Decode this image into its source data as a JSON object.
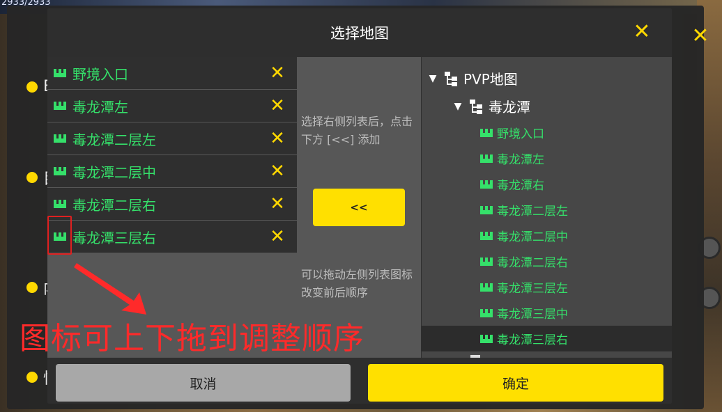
{
  "background": {
    "hp_text": "2933/2933",
    "side_rows": [
      {
        "label": "B"
      },
      {
        "label": "目"
      },
      {
        "label": "内"
      },
      {
        "label": "快"
      }
    ]
  },
  "dialog": {
    "title": "选择地图",
    "close_icon": "close-icon",
    "selected_maps": [
      {
        "name": "野境入口"
      },
      {
        "name": "毒龙潭左"
      },
      {
        "name": "毒龙潭二层左"
      },
      {
        "name": "毒龙潭二层中"
      },
      {
        "name": "毒龙潭二层右"
      },
      {
        "name": "毒龙潭三层右"
      }
    ],
    "hint_top": "选择右侧列表后，点击下方 [<<] 添加",
    "add_button": "<<",
    "hint_bottom": "可以拖动左侧列表图标改变前后顺序",
    "tree": {
      "root": "PVP地图",
      "group": "毒龙潭",
      "leaves": [
        {
          "name": "野境入口",
          "selected": false
        },
        {
          "name": "毒龙潭左",
          "selected": false
        },
        {
          "name": "毒龙潭右",
          "selected": false
        },
        {
          "name": "毒龙潭二层左",
          "selected": false
        },
        {
          "name": "毒龙潭二层中",
          "selected": false
        },
        {
          "name": "毒龙潭二层右",
          "selected": false
        },
        {
          "name": "毒龙潭三层左",
          "selected": false
        },
        {
          "name": "毒龙潭三层中",
          "selected": false
        },
        {
          "name": "毒龙潭三层右",
          "selected": true
        }
      ]
    },
    "cancel_button": "取消",
    "ok_button": "确定"
  },
  "annotation": {
    "text": "图标可上下拖到调整顺序"
  },
  "colors": {
    "accent_yellow": "#ffe000",
    "map_green": "#35e06a",
    "annotation_red": "#ff2a2a"
  }
}
